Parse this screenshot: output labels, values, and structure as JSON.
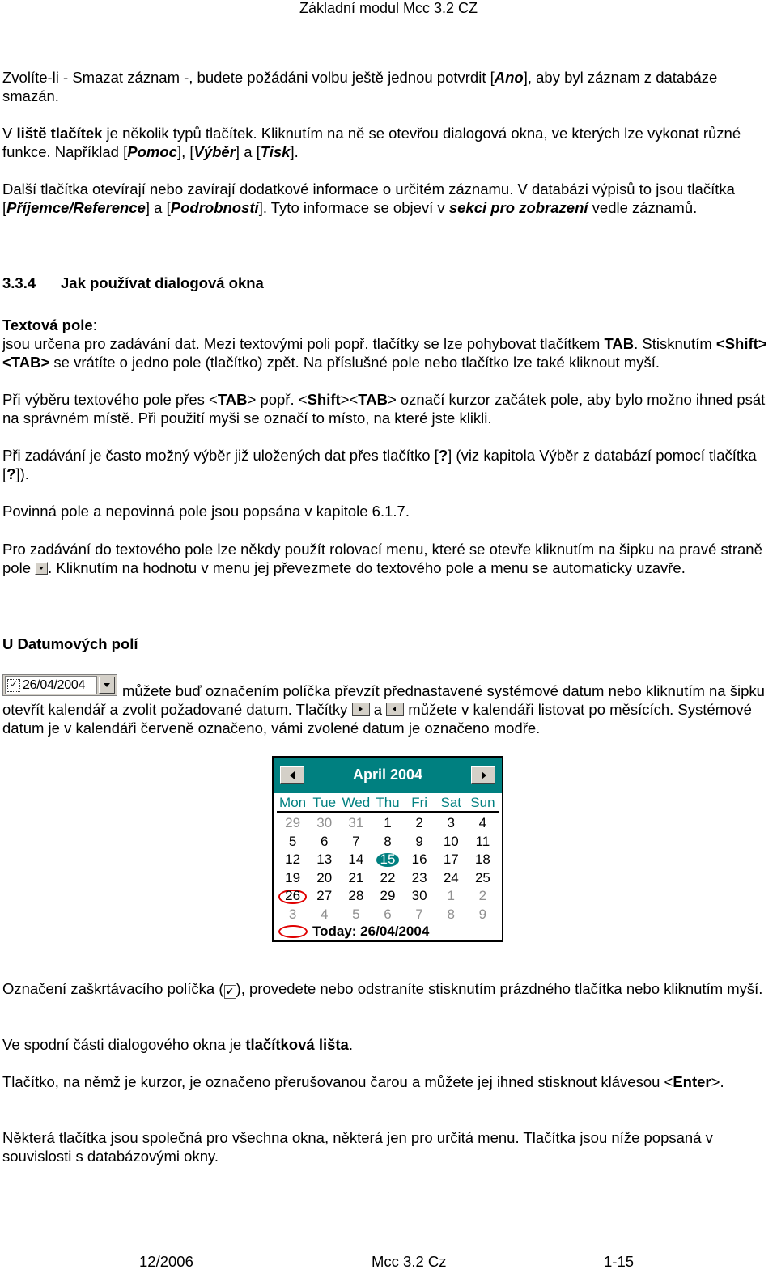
{
  "header": {
    "title": "Základní modul Mcc 3.2 CZ"
  },
  "paragraphs": {
    "p1": {
      "a": "Zvolíte-li - Smazat záznam -, budete požádáni volbu ještě jednou potvrdit [",
      "b": "Ano",
      "c": "], aby byl záznam z databáze smazán."
    },
    "p2": {
      "a": "V ",
      "b": "liště tlačítek",
      "c": "  je několik typů tlačítek. Kliknutím na ně se otevřou dialogová okna, ve kterých lze vykonat různé funkce. Například [",
      "d": "Pomoc",
      "e": "], [",
      "f": "Výběr",
      "g": "] a [",
      "h": "Tisk",
      "i": "]."
    },
    "p3": {
      "a": "Další tlačítka otevírají nebo zavírají dodatkové informace o určitém záznamu. V databázi výpisů to jsou tlačítka [",
      "b": "Příjemce/Reference",
      "c": "] a [",
      "d": "Podrobnosti",
      "e": "]. Tyto informace se objeví v ",
      "f": "sekci pro zobrazení",
      "g": " vedle záznamů."
    },
    "section": {
      "number": "3.3.4",
      "title": "Jak používat dialogová okna"
    },
    "p4": {
      "label": "Textová pole",
      "colon": ":",
      "a": "jsou určena pro zadávání dat. Mezi textovými poli popř. tlačítky se lze pohybovat tlačítkem ",
      "b": "TAB",
      "c": ". Stisknutím ",
      "d": "<Shift>",
      "e": "<TAB>",
      "f": " se vrátíte o jedno pole (tlačítko) zpět. Na příslušné pole nebo tlačítko lze také kliknout myší."
    },
    "p5": {
      "a": "Při výběru textového pole přes <",
      "b": "TAB",
      "c": "> popř. <",
      "d": "Shift",
      "e": "><",
      "f": "TAB",
      "g": "> označí kurzor začátek pole, aby bylo možno ihned psát na správném místě. Při použití myši se označí to místo, na které jste klikli."
    },
    "p6": {
      "a": "Při zadávání je často možný výběr již uložených dat přes tlačítko [",
      "b": "?",
      "c": "] (viz kapitola Výběr z databází pomocí tlačítka  [",
      "d": "?",
      "e": "])."
    },
    "p7": {
      "a": "Povinná pole a nepovinná pole jsou popsána v kapitole 6.1.7."
    },
    "p8": {
      "a": "Pro zadávání do textového pole lze někdy použít rolovací menu, které se otevře kliknutím na šipku na pravé straně pole ",
      "b": ". Kliknutím na hodnotu v menu jej převezmete do textového pole a menu se automaticky uzavře."
    },
    "subheading": "U Datumových polí",
    "p9": {
      "a": " můžete buď označením políčka převzít přednastavené systémové datum nebo kliknutím na šipku otevřít kalendář a zvolit požadované datum. Tlačítky ",
      "b": " a ",
      "c": " můžete v kalendáři listovat po měsících. Systémové datum je v kalendáři červeně označeno, vámi zvolené datum je označeno modře."
    },
    "p10": {
      "a": "Označení zaškrtávacího políčka (",
      "b": "), provedete nebo odstraníte stisknutím prázdného tlačítka nebo kliknutím myší."
    },
    "p11": {
      "a": "Ve spodní části dialogového okna je ",
      "b": "tlačítková lišta",
      "c": "."
    },
    "p12": {
      "a": "Tlačítko, na němž je kurzor, je označeno přerušovanou čarou a můžete jej ihned stisknout klávesou <",
      "b": "Enter",
      "c": ">."
    },
    "p13": {
      "a": "Některá tlačítka jsou společná pro všechna okna, některá jen pro určitá menu. Tlačítka jsou níže popsaná v souvislosti s databázovými okny."
    }
  },
  "datepicker": {
    "value": "26/04/2004",
    "checked": true,
    "check_glyph": "✓"
  },
  "calendar": {
    "title": "April 2004",
    "accent": "#008080",
    "today_color": "#e00000",
    "weekdays": [
      "Mon",
      "Tue",
      "Wed",
      "Thu",
      "Fri",
      "Sat",
      "Sun"
    ],
    "days": [
      {
        "d": "29",
        "t": "other"
      },
      {
        "d": "30",
        "t": "other"
      },
      {
        "d": "31",
        "t": "other"
      },
      {
        "d": "1"
      },
      {
        "d": "2"
      },
      {
        "d": "3"
      },
      {
        "d": "4"
      },
      {
        "d": "5"
      },
      {
        "d": "6"
      },
      {
        "d": "7"
      },
      {
        "d": "8"
      },
      {
        "d": "9"
      },
      {
        "d": "10"
      },
      {
        "d": "11"
      },
      {
        "d": "12"
      },
      {
        "d": "13"
      },
      {
        "d": "14"
      },
      {
        "d": "15",
        "t": "selected"
      },
      {
        "d": "16"
      },
      {
        "d": "17"
      },
      {
        "d": "18"
      },
      {
        "d": "19"
      },
      {
        "d": "20"
      },
      {
        "d": "21"
      },
      {
        "d": "22"
      },
      {
        "d": "23"
      },
      {
        "d": "24"
      },
      {
        "d": "25"
      },
      {
        "d": "26",
        "t": "today"
      },
      {
        "d": "27"
      },
      {
        "d": "28"
      },
      {
        "d": "29"
      },
      {
        "d": "30"
      },
      {
        "d": "1",
        "t": "other"
      },
      {
        "d": "2",
        "t": "other"
      },
      {
        "d": "3",
        "t": "other"
      },
      {
        "d": "4",
        "t": "other"
      },
      {
        "d": "5",
        "t": "other"
      },
      {
        "d": "6",
        "t": "other"
      },
      {
        "d": "7",
        "t": "other"
      },
      {
        "d": "8",
        "t": "other"
      },
      {
        "d": "9",
        "t": "other"
      }
    ],
    "today_label": "Today: 26/04/2004"
  },
  "footer": {
    "date": "12/2006",
    "product": "Mcc 3.2 Cz",
    "page": "1-15"
  }
}
